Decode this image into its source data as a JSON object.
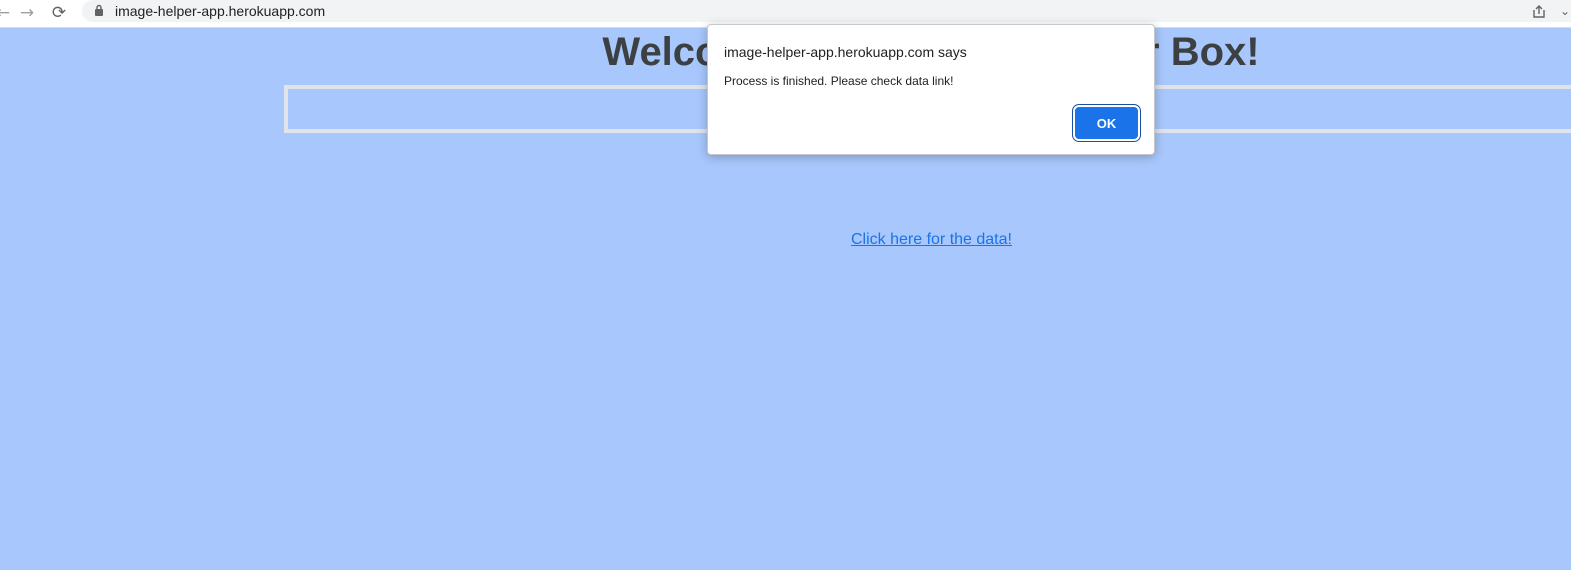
{
  "browser": {
    "url": "image-helper-app.herokuapp.com",
    "icons": {
      "back": "back-arrow-icon",
      "forward": "forward-arrow-icon",
      "reload": "reload-icon",
      "lock": "lock-icon",
      "share": "share-icon",
      "extension": "chevron-down-icon"
    }
  },
  "page": {
    "heading": "Welcome to the Image Helper Box!",
    "link_text": "Click here for the data!",
    "background_color": "#a8c7fc"
  },
  "dialog": {
    "title": "image-helper-app.herokuapp.com says",
    "message": "Process is finished. Please check data link!",
    "ok_label": "OK",
    "button_color": "#1a73e8"
  }
}
